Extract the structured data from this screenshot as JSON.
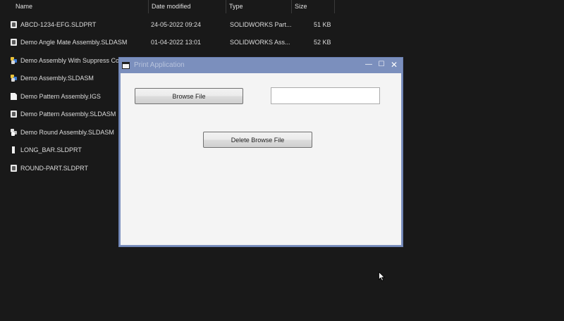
{
  "explorer": {
    "columns": {
      "name": "Name",
      "date": "Date modified",
      "type": "Type",
      "size": "Size"
    },
    "sort_indicator": "^",
    "files": [
      {
        "name": "ABCD-1234-EFG.SLDPRT",
        "date": "24-05-2022 09:24",
        "type": "SOLIDWORKS Part...",
        "size": "51 KB",
        "icon": "part-file-icon"
      },
      {
        "name": "Demo Angle Mate Assembly.SLDASM",
        "date": "01-04-2022 13:01",
        "type": "SOLIDWORKS Ass...",
        "size": "52 KB",
        "icon": "assembly-file-icon"
      },
      {
        "name": "Demo Assembly With Suppress Co",
        "date": "",
        "type": "",
        "size": "",
        "icon": "assembly-file-icon"
      },
      {
        "name": "Demo Assembly.SLDASM",
        "date": "",
        "type": "",
        "size": "",
        "icon": "assembly-file-icon"
      },
      {
        "name": "Demo Pattern Assembly.IGS",
        "date": "",
        "type": "",
        "size": "",
        "icon": "document-file-icon"
      },
      {
        "name": "Demo Pattern Assembly.SLDASM",
        "date": "",
        "type": "",
        "size": "",
        "icon": "part-file-icon"
      },
      {
        "name": "Demo Round Assembly.SLDASM",
        "date": "",
        "type": "",
        "size": "",
        "icon": "assembly-file-icon"
      },
      {
        "name": "LONG_BAR.SLDPRT",
        "date": "",
        "type": "",
        "size": "",
        "icon": "bar-part-icon"
      },
      {
        "name": "ROUND-PART.SLDPRT",
        "date": "",
        "type": "",
        "size": "",
        "icon": "part-file-icon"
      }
    ]
  },
  "dialog": {
    "title": "Print Application",
    "minimize_glyph": "—",
    "maximize_glyph": "☐",
    "close_glyph": "✕",
    "browse_button": "Browse File",
    "path_field_value": "",
    "delete_button": "Delete Browse File"
  },
  "colors": {
    "explorer_bg": "#191919",
    "window_frame": "#7b8fbd",
    "client_bg": "#f4f4f4"
  }
}
